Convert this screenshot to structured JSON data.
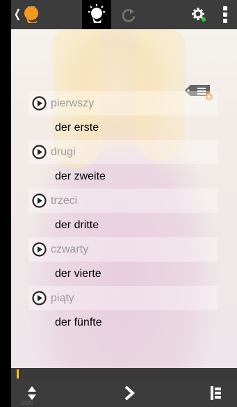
{
  "topbar": {
    "icons": [
      "back-chevron-icon",
      "lightbulb-head-icon",
      "lightbulb-head-active-icon",
      "refresh-icon",
      "gear-icon",
      "more-vertical-icon"
    ]
  },
  "words": [
    {
      "source": "pierwszy",
      "target": "der erste"
    },
    {
      "source": "drugi",
      "target": "der zweite"
    },
    {
      "source": "trzeci",
      "target": "der dritte"
    },
    {
      "source": "czwarty",
      "target": "der vierte"
    },
    {
      "source": "piąty",
      "target": "der fünfte"
    }
  ],
  "progress": {
    "value": 0.01
  },
  "bottombar": {
    "counter": "2/0/0",
    "icons": [
      "sort-arrows-icon",
      "next-chevron-icon",
      "list-icon"
    ]
  },
  "colors": {
    "bar": "#3c3c3c",
    "accent": "#f7c600",
    "source_text": "#9a9a9a",
    "target_text": "#000000"
  }
}
